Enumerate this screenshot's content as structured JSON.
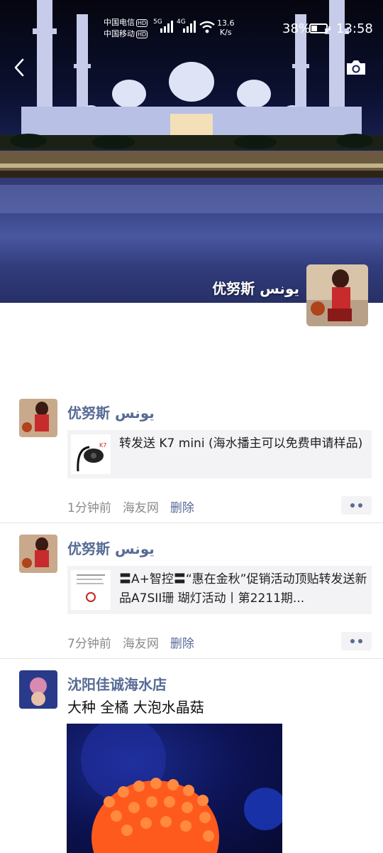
{
  "status_bar": {
    "carrier1": "中国电信",
    "carrier2": "中国移动",
    "hd": "HD",
    "net1": "5G",
    "net2": "4G",
    "speed_value": "13.6",
    "speed_unit": "K/s",
    "battery_pct": "38%",
    "battery_level": 0.38,
    "time": "13:58"
  },
  "profile": {
    "name": "优努斯 يونس"
  },
  "posts": [
    {
      "author": "优努斯 يونس",
      "share_text": "转发送 K7 mini (海水播主可以免费申请样品)",
      "time": "1分钟前",
      "source": "海友网",
      "delete": "删除"
    },
    {
      "author": "优努斯 يونس",
      "share_text": "〓A+智控〓“惠在金秋”促销活动顶贴转发送新品A7SII珊 瑚灯活动丨第2211期...",
      "time": "7分钟前",
      "source": "海友网",
      "delete": "删除"
    },
    {
      "author": "沈阳佳诚海水店",
      "text": "大种 全橘 大泡水晶菇"
    }
  ]
}
